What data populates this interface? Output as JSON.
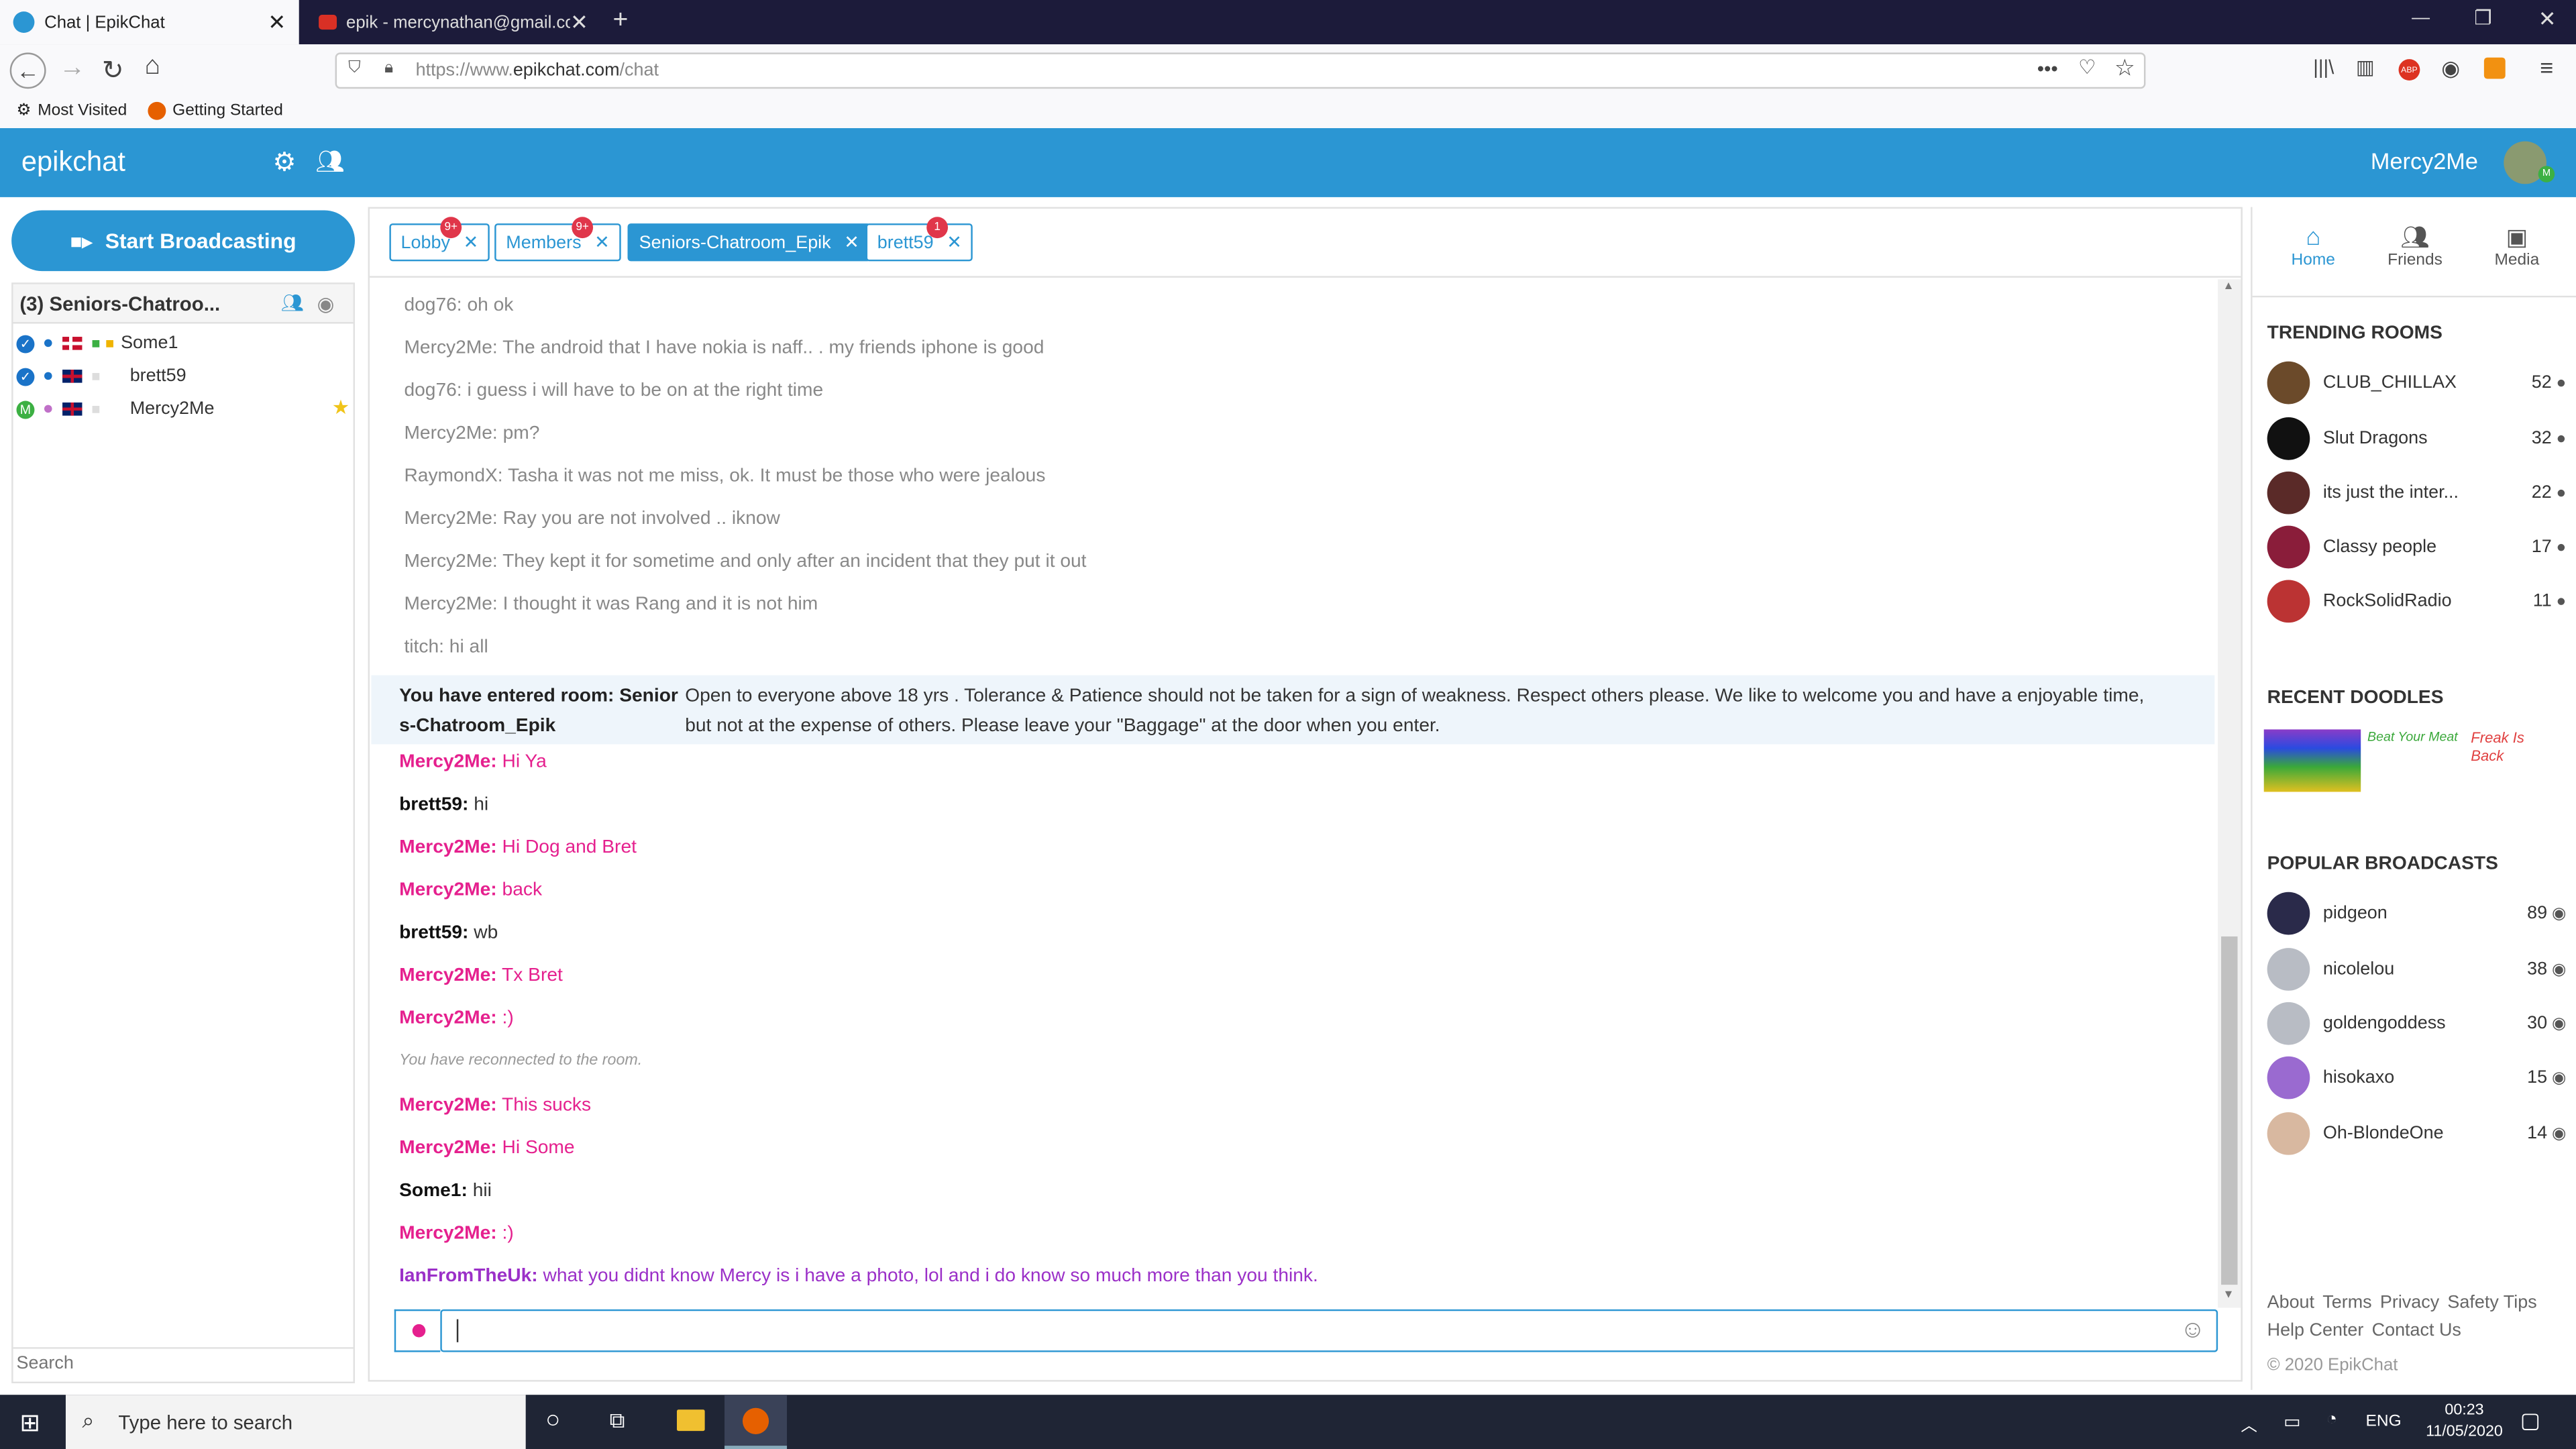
{
  "browser": {
    "tabs": [
      {
        "label": "Chat | EpikChat"
      },
      {
        "label": "epik - mercynathan@gmail.co"
      }
    ],
    "url_prefix": "https://www.",
    "url_domain": "epikchat.com",
    "url_path": "/chat",
    "bookmarks": [
      "Most Visited",
      "Getting Started"
    ]
  },
  "app": {
    "brand": "epikchat",
    "username": "Mercy2Me",
    "broadcast_label": "Start Broadcasting"
  },
  "room": {
    "title": "(3) Seniors-Chatroo...",
    "users": [
      {
        "name": "Some1"
      },
      {
        "name": "brett59"
      },
      {
        "name": "Mercy2Me"
      }
    ],
    "search_placeholder": "Search"
  },
  "chat_tabs": [
    {
      "label": "Lobby",
      "badge": "9+"
    },
    {
      "label": "Members",
      "badge": "9+"
    },
    {
      "label": "Seniors-Chatroom_Epik",
      "badge": ""
    },
    {
      "label": "brett59",
      "badge": "1"
    }
  ],
  "history": [
    {
      "user": "dog76:",
      "text": "oh ok"
    },
    {
      "user": "Mercy2Me:",
      "text": "The android that I have nokia is naff.. . my friends iphone is good"
    },
    {
      "user": "dog76:",
      "text": "i guess i will have to be on at the right time"
    },
    {
      "user": "Mercy2Me:",
      "text": "pm?"
    },
    {
      "user": "RaymondX:",
      "text": "Tasha it was not me miss, ok. It must be those who were jealous"
    },
    {
      "user": "Mercy2Me:",
      "text": "Ray you are not involved .. iknow"
    },
    {
      "user": "Mercy2Me:",
      "text": "They kept it for sometime and only after an incident that they put it out"
    },
    {
      "user": "Mercy2Me:",
      "text": "I thought it was Rang and it is not him"
    },
    {
      "user": "titch:",
      "text": "hi all"
    }
  ],
  "entered": {
    "label_line1": "You have entered room: Senior",
    "label_line2": "s-Chatroom_Epik",
    "desc_line1": "Open to everyone above 18 yrs . Tolerance & Patience should not be taken for a sign of weakness. Respect others please. We like to welcome you and have a enjoyable time,",
    "desc_line2": "but not at the expense of others. Please leave your \"Baggage\" at the door when you enter."
  },
  "messages": [
    {
      "user": "Mercy2Me:",
      "text": "Hi Ya",
      "color": "pink"
    },
    {
      "user": "brett59:",
      "text": "hi",
      "color": "dark"
    },
    {
      "user": "Mercy2Me:",
      "text": "Hi Dog and Bret",
      "color": "pink"
    },
    {
      "user": "Mercy2Me:",
      "text": "back",
      "color": "pink"
    },
    {
      "user": "brett59:",
      "text": "wb",
      "color": "dark"
    },
    {
      "user": "Mercy2Me:",
      "text": "Tx Bret",
      "color": "pink"
    },
    {
      "user": "Mercy2Me:",
      "text": ":)",
      "color": "pink"
    }
  ],
  "system_note": "You have reconnected to the room.",
  "messages2": [
    {
      "user": "Mercy2Me:",
      "text": "This sucks",
      "color": "pink"
    },
    {
      "user": "Mercy2Me:",
      "text": "Hi Some",
      "color": "pink"
    },
    {
      "user": "Some1:",
      "text": "hii",
      "color": "dark"
    },
    {
      "user": "Mercy2Me:",
      "text": ":)",
      "color": "pink"
    },
    {
      "user": "IanFromTheUk:",
      "text": "what you didnt know Mercy is i have a photo, lol and i do know so much more than you think.",
      "color": "purple"
    }
  ],
  "right": {
    "nav": [
      "Home",
      "Friends",
      "Media"
    ],
    "trending_title": "TRENDING ROOMS",
    "trending": [
      {
        "name": "CLUB_CHILLAX",
        "count": "52"
      },
      {
        "name": "Slut Dragons",
        "count": "32"
      },
      {
        "name": "its just the inter...",
        "count": "22"
      },
      {
        "name": "Classy people",
        "count": "17"
      },
      {
        "name": "RockSolidRadio",
        "count": "11"
      }
    ],
    "doodles_title": "RECENT DOODLES",
    "doodle_texts": [
      "Beat Your Meat",
      "Freak Is Back"
    ],
    "broadcasts_title": "POPULAR BROADCASTS",
    "broadcasts": [
      {
        "name": "pidgeon",
        "count": "89"
      },
      {
        "name": "nicolelou",
        "count": "38"
      },
      {
        "name": "goldengoddess",
        "count": "30"
      },
      {
        "name": "hisokaxo",
        "count": "15"
      },
      {
        "name": "Oh-BlondeOne",
        "count": "14"
      }
    ],
    "footer_row1": [
      "About",
      "Terms",
      "Privacy",
      "Safety Tips"
    ],
    "footer_row2": [
      "Help Center",
      "Contact Us"
    ],
    "copyright": "© 2020 EpikChat"
  },
  "taskbar": {
    "search_placeholder": "Type here to search",
    "lang": "ENG",
    "time": "00:23",
    "date": "11/05/2020"
  }
}
